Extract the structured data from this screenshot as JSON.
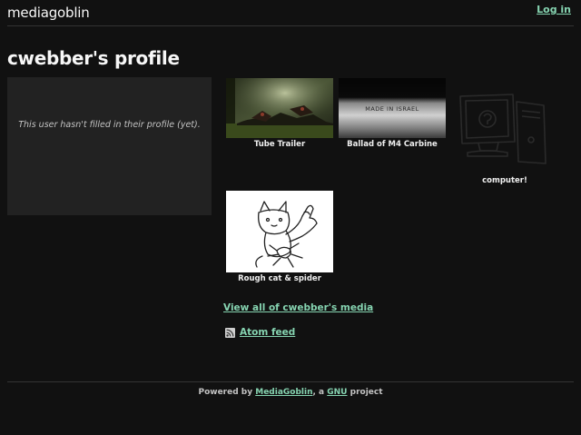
{
  "header": {
    "logo": "mediagoblin",
    "login_label": "Log in"
  },
  "profile": {
    "title": "cwebber's profile",
    "empty_message": "This user hasn't filled in their profile (yet)."
  },
  "media": [
    {
      "caption": "Tube Trailer"
    },
    {
      "caption": "Ballad of M4 Carbine",
      "image_text": "MADE IN ISRAEL"
    },
    {
      "caption": "computer!"
    },
    {
      "caption": "Rough cat & spider"
    }
  ],
  "links": {
    "view_all": "View all of cwebber's media",
    "atom_feed": "Atom feed"
  },
  "footer": {
    "prefix": "Powered by ",
    "mediagoblin": "MediaGoblin",
    "middle": ", a ",
    "gnu": "GNU",
    "suffix": " project"
  },
  "colors": {
    "background": "#111111",
    "panel": "#222222",
    "link": "#86d4b1",
    "text": "#c3c3c3"
  },
  "icons": {
    "feed": "rss-feed-icon"
  }
}
